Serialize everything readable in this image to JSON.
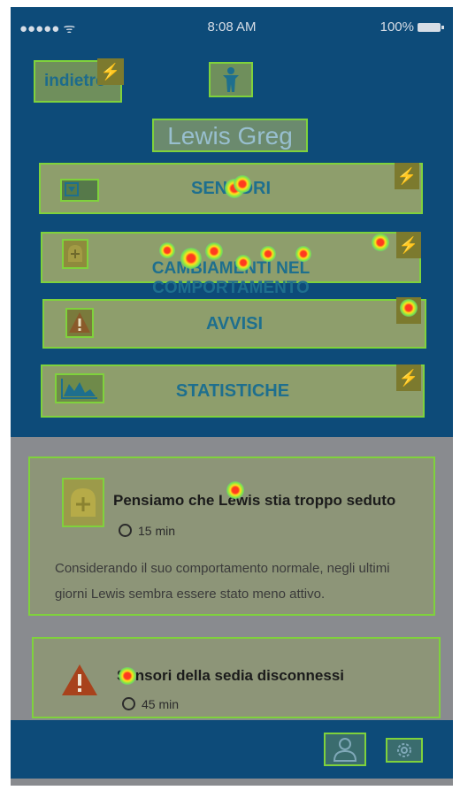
{
  "statusbar": {
    "signal": "●●●●● ᯤ",
    "time": "8:08 AM",
    "battery": "100%"
  },
  "header": {
    "back_label": "indietro",
    "bolt": "⚡",
    "user_name": "Lewis Greg"
  },
  "menu": [
    {
      "label": "SENSORI",
      "icon": "sensor-icon"
    },
    {
      "label": "CAMBIAMENTI NEL\nCOMPORTAMENTO",
      "icon": "behavior-change-icon"
    },
    {
      "label": "AVVISI",
      "icon": "warning-icon"
    },
    {
      "label": "STATISTICHE",
      "icon": "chart-icon"
    }
  ],
  "alerts": [
    {
      "title": "Pensiamo che Lewis stia troppo seduto",
      "time": "15 min",
      "description": "Considerando il suo comportamento normale, negli ultimi giorni Lewis sembra essere stato meno attivo.",
      "icon": "bell-plus-icon"
    },
    {
      "title": "Sensori della sedia disconnessi",
      "time": "45 min",
      "icon": "warning-icon"
    }
  ],
  "tabbar": {
    "icons": [
      "profile-icon",
      "settings-icon"
    ]
  },
  "colors": {
    "header_blue": "#0d4b79",
    "highlight_green": "#7fd23c",
    "warning_red": "#b5451c"
  }
}
